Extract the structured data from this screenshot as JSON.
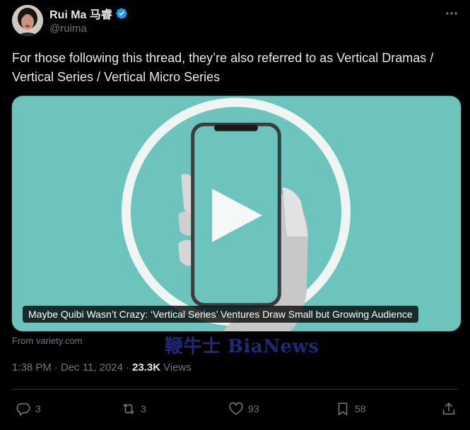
{
  "author": {
    "name": "Rui Ma 马睿",
    "handle": "@ruima",
    "verified_color": "#1d9bf0"
  },
  "tweet": {
    "text": "For those following this thread, they’re also referred to as Vertical Dramas / Vertical Series / Vertical Micro Series"
  },
  "card": {
    "caption": "Maybe Quibi Wasn’t Crazy: ‘Vertical Series’ Ventures Draw Small but Growing Audience",
    "source": "From variety.com",
    "background_color": "#6cc4bd"
  },
  "watermark": "鞭牛士 BiaNews",
  "meta": {
    "time": "1:38 PM",
    "separator": "·",
    "date": "Dec 11, 2024",
    "separator2": "·",
    "views_count": "23.3K",
    "views_label": "Views"
  },
  "actions": {
    "replies": "3",
    "retweets": "3",
    "likes": "93",
    "bookmarks": "58"
  },
  "icons": {
    "more": "more-icon",
    "reply": "reply-icon",
    "retweet": "retweet-icon",
    "like": "heart-icon",
    "bookmark": "bookmark-icon",
    "share": "share-icon",
    "verified": "verified-badge-icon"
  }
}
